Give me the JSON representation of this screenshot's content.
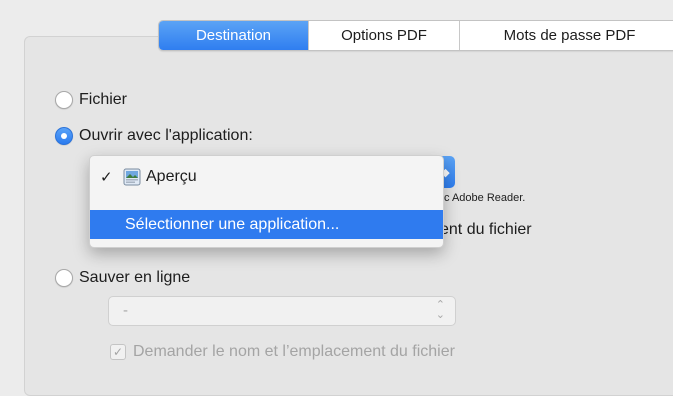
{
  "tabs": [
    {
      "label": "Destination",
      "active": true
    },
    {
      "label": "Options PDF",
      "active": false
    },
    {
      "label": "Mots de passe PDF",
      "active": false
    }
  ],
  "destination": {
    "fichier_label": "Fichier",
    "ouvrir_label": "Ouvrir avec l'application:",
    "sauver_label": "Sauver en ligne",
    "selected_option": "Ouvrir avec l'application:"
  },
  "app_menu": {
    "check_mark": "✓",
    "selected_app": "Aperçu",
    "select_app_label": "Sélectionner une application...",
    "icon": "preview-app-icon"
  },
  "partially_hidden": {
    "note_text": "c Adobe Reader.",
    "checkbox_text": "ent du fichier"
  },
  "online": {
    "select_value": "-",
    "checkbox_checked": true,
    "checkbox_label": "Demander le nom et l’emplacement du fichier"
  },
  "colors": {
    "accent": "#2f7bef",
    "background": "#ececec",
    "disabled_text": "#a4a4a4"
  }
}
